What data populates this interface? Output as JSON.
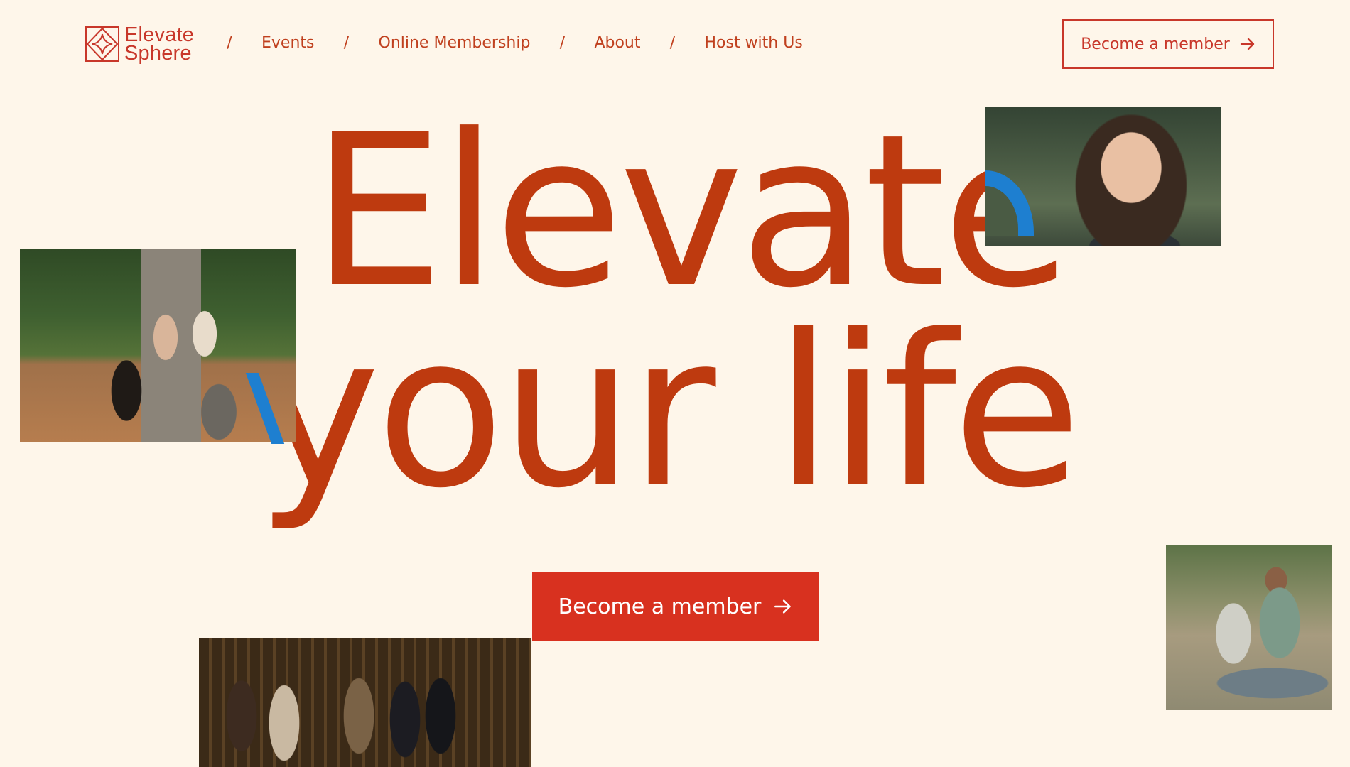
{
  "brand": {
    "name_line1": "Elevate",
    "name_line2": "Sphere",
    "logo_icon": "diamond-star-icon"
  },
  "nav": {
    "separator": "/",
    "items": [
      {
        "label": "Events"
      },
      {
        "label": "Online Membership"
      },
      {
        "label": "About"
      },
      {
        "label": "Host with Us"
      }
    ]
  },
  "header": {
    "cta_label": "Become a member",
    "cta_icon": "arrow-right-icon"
  },
  "hero": {
    "line1": "Elevate",
    "line2": "your life",
    "cta_label": "Become a member",
    "cta_icon": "arrow-right-icon"
  },
  "photos": [
    {
      "name": "smiling-woman-photo"
    },
    {
      "name": "women-circle-photo"
    },
    {
      "name": "group-socializing-photo"
    },
    {
      "name": "men-meditating-photo"
    }
  ],
  "colors": {
    "background": "#FEF6EA",
    "brand_red": "#C8372A",
    "hero_text": "#BE3A0F",
    "cta_fill": "#D8311F",
    "accent_blue": "#1E7FD0"
  }
}
